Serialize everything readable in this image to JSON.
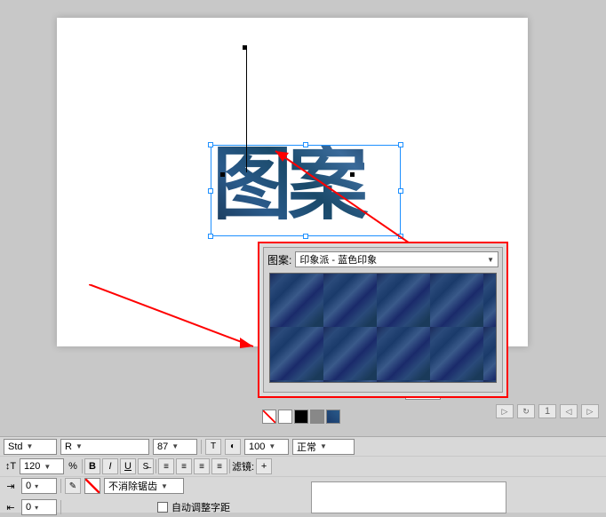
{
  "canvas": {
    "text": "图案"
  },
  "pattern_panel": {
    "label": "图案:",
    "selected": "印象派 - 蓝色印象"
  },
  "rotate": {
    "value": "0"
  },
  "playback": {
    "frame": "1"
  },
  "font_bar": {
    "family": "Std",
    "style": "R",
    "size": "87",
    "opacity": "100",
    "blend": "正常"
  },
  "format_bar": {
    "leading_icon": "↕T",
    "leading": "120",
    "tracking": "%",
    "filter_label": "滤镜:",
    "filter_add": "+"
  },
  "spacing": {
    "row1_val": "0",
    "row2_val": "0",
    "aa_label": "不消除锯齿",
    "autokern": "自动调整字距"
  },
  "btns": {
    "bold": "B",
    "italic": "I",
    "underline": "U"
  }
}
